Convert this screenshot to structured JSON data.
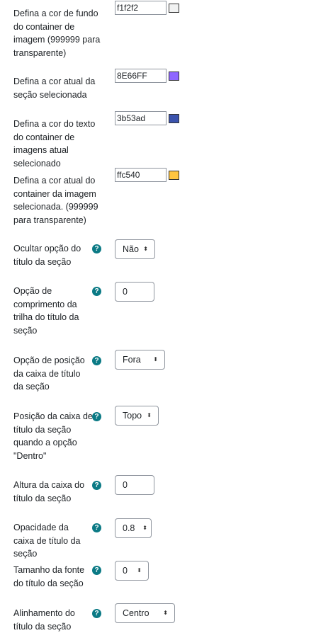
{
  "fields": {
    "bg_color": {
      "label": "Defina a cor de fundo do container de imagem (999999 para transparente)",
      "value": "f1f2f2",
      "swatch": "#f1f2f2"
    },
    "section_color": {
      "label": "Defina a cor atual da seção selecionada",
      "value": "8E66FF",
      "swatch": "#8E66FF"
    },
    "text_color": {
      "label": "Defina a cor do texto do container de imagens atual selecionado",
      "value": "3b53ad",
      "swatch": "#3b53ad"
    },
    "current_color": {
      "label": "Defina a cor atual do container da imagem selecionada. (999999 para transparente)",
      "value": "ffc540",
      "swatch": "#ffc540"
    },
    "hide_title": {
      "label": "Ocultar opção do título da seção",
      "help": "?",
      "value": "Não",
      "arrow": "⬍"
    },
    "trail_length": {
      "label": "Opção de comprimento da trilha do título da seção",
      "help": "?",
      "value": "0"
    },
    "title_box_position": {
      "label": "Opção de posição da caixa de título da seção",
      "help": "?",
      "value": "Fora",
      "arrow": "⬍"
    },
    "title_box_inside_position": {
      "label": "Posição da caixa de título da seção quando a opção \"Dentro\"",
      "help": "?",
      "value": "Topo",
      "arrow": "⬍"
    },
    "title_box_height": {
      "label": "Altura da caixa do título da seção",
      "help": "?",
      "value": "0"
    },
    "title_box_opacity": {
      "label": "Opacidade da caixa de título da seção",
      "help": "?",
      "value": "0.8",
      "arrow": "⬍"
    },
    "title_font_size": {
      "label": "Tamanho da fonte do título da seção",
      "help": "?",
      "value": "0",
      "arrow": "⬍"
    },
    "title_alignment": {
      "label": "Alinhamento do título da seção",
      "help": "?",
      "value": "Centro",
      "arrow": "⬍"
    }
  }
}
